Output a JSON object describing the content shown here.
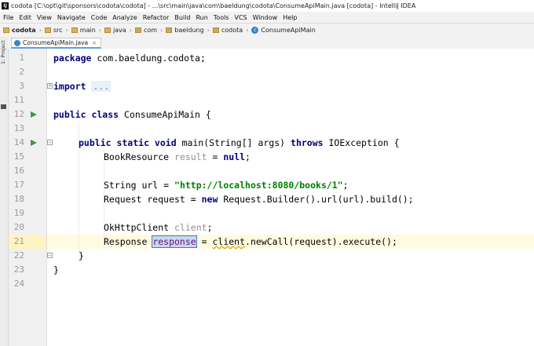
{
  "window": {
    "title": "codota [C:\\opt\\git\\sponsors\\codota\\codota] - ...\\src\\main\\java\\com\\baeldung\\codota\\ConsumeApiMain.java [codota] - IntelliJ IDEA",
    "app_icon_text": "IJ"
  },
  "menu": {
    "items": [
      "File",
      "Edit",
      "View",
      "Navigate",
      "Code",
      "Analyze",
      "Refactor",
      "Build",
      "Run",
      "Tools",
      "VCS",
      "Window",
      "Help"
    ]
  },
  "breadcrumb": {
    "items": [
      "codota",
      "src",
      "main",
      "java",
      "com",
      "baeldung",
      "codota",
      "ConsumeApiMain"
    ]
  },
  "tabs": [
    {
      "label": "ConsumeApiMain.java",
      "close": "×"
    }
  ],
  "sidebar": {
    "project_label": "1: Project"
  },
  "editor": {
    "lines": [
      "1",
      "2",
      "3",
      "11",
      "12",
      "13",
      "14",
      "15",
      "16",
      "17",
      "18",
      "19",
      "20",
      "21",
      "22",
      "23",
      "24"
    ],
    "current_line": "21",
    "folded_import": "...",
    "colors": {
      "keyword": "#000080",
      "string": "#008000",
      "field": "#660e7a",
      "unused": "#909090"
    },
    "code": {
      "l1": {
        "kw": "package",
        "rest": " com.baeldung.codota;"
      },
      "l3": {
        "kw": "import",
        "fold": "..."
      },
      "l12": {
        "kw": "public class",
        "rest": " ConsumeApiMain {"
      },
      "l14": {
        "kw1": "public static void",
        "mid": " main(String[] args) ",
        "kw2": "throws",
        "rest": " IOException {"
      },
      "l15": {
        "type": "BookResource ",
        "var": "result",
        "eq": " = ",
        "kw": "null",
        "end": ";"
      },
      "l17": {
        "pre": "String url = ",
        "str": "\"http://localhost:8080/books/1\"",
        "end": ";"
      },
      "l18": {
        "pre": "Request request = ",
        "kw": "new",
        "rest": " Request.Builder().url(url).build();"
      },
      "l20": {
        "type": "OkHttpClient ",
        "var": "client",
        "end": ";"
      },
      "l21": {
        "type": "Response ",
        "sel": "response",
        "eq": " = ",
        "call": "client",
        "rest": ".newCall(request).execute();"
      },
      "l22": {
        "text": "}"
      },
      "l23": {
        "text": "}"
      }
    }
  }
}
